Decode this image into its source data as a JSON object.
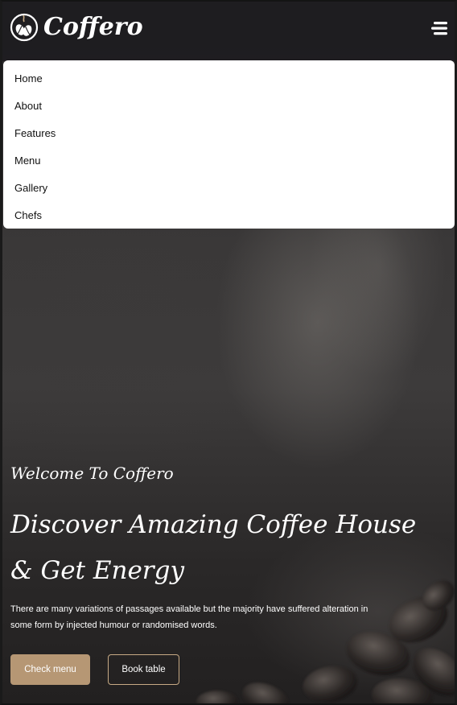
{
  "brand": {
    "name": "Coffero",
    "logo_icon": "coffee-bean-icon"
  },
  "header": {
    "menu_icon": "hamburger-menu-icon"
  },
  "nav": {
    "items": [
      {
        "label": "Home"
      },
      {
        "label": "About"
      },
      {
        "label": "Features"
      },
      {
        "label": "Menu"
      },
      {
        "label": "Gallery"
      },
      {
        "label": "Chefs"
      }
    ]
  },
  "hero": {
    "kicker": "Welcome To Coffero",
    "title_line1": "Discover Amazing Coffee House",
    "title_line2": "& Get Energy",
    "description": "There are many variations of passages available but the majority have suffered alteration in some form by injected humour or randomised words.",
    "primary_button": "Check menu",
    "secondary_button": "Book table"
  },
  "colors": {
    "accent": "#b69774",
    "outline": "#c7aa85",
    "nav_background": "#ffffff",
    "text_light": "#ffffff"
  }
}
